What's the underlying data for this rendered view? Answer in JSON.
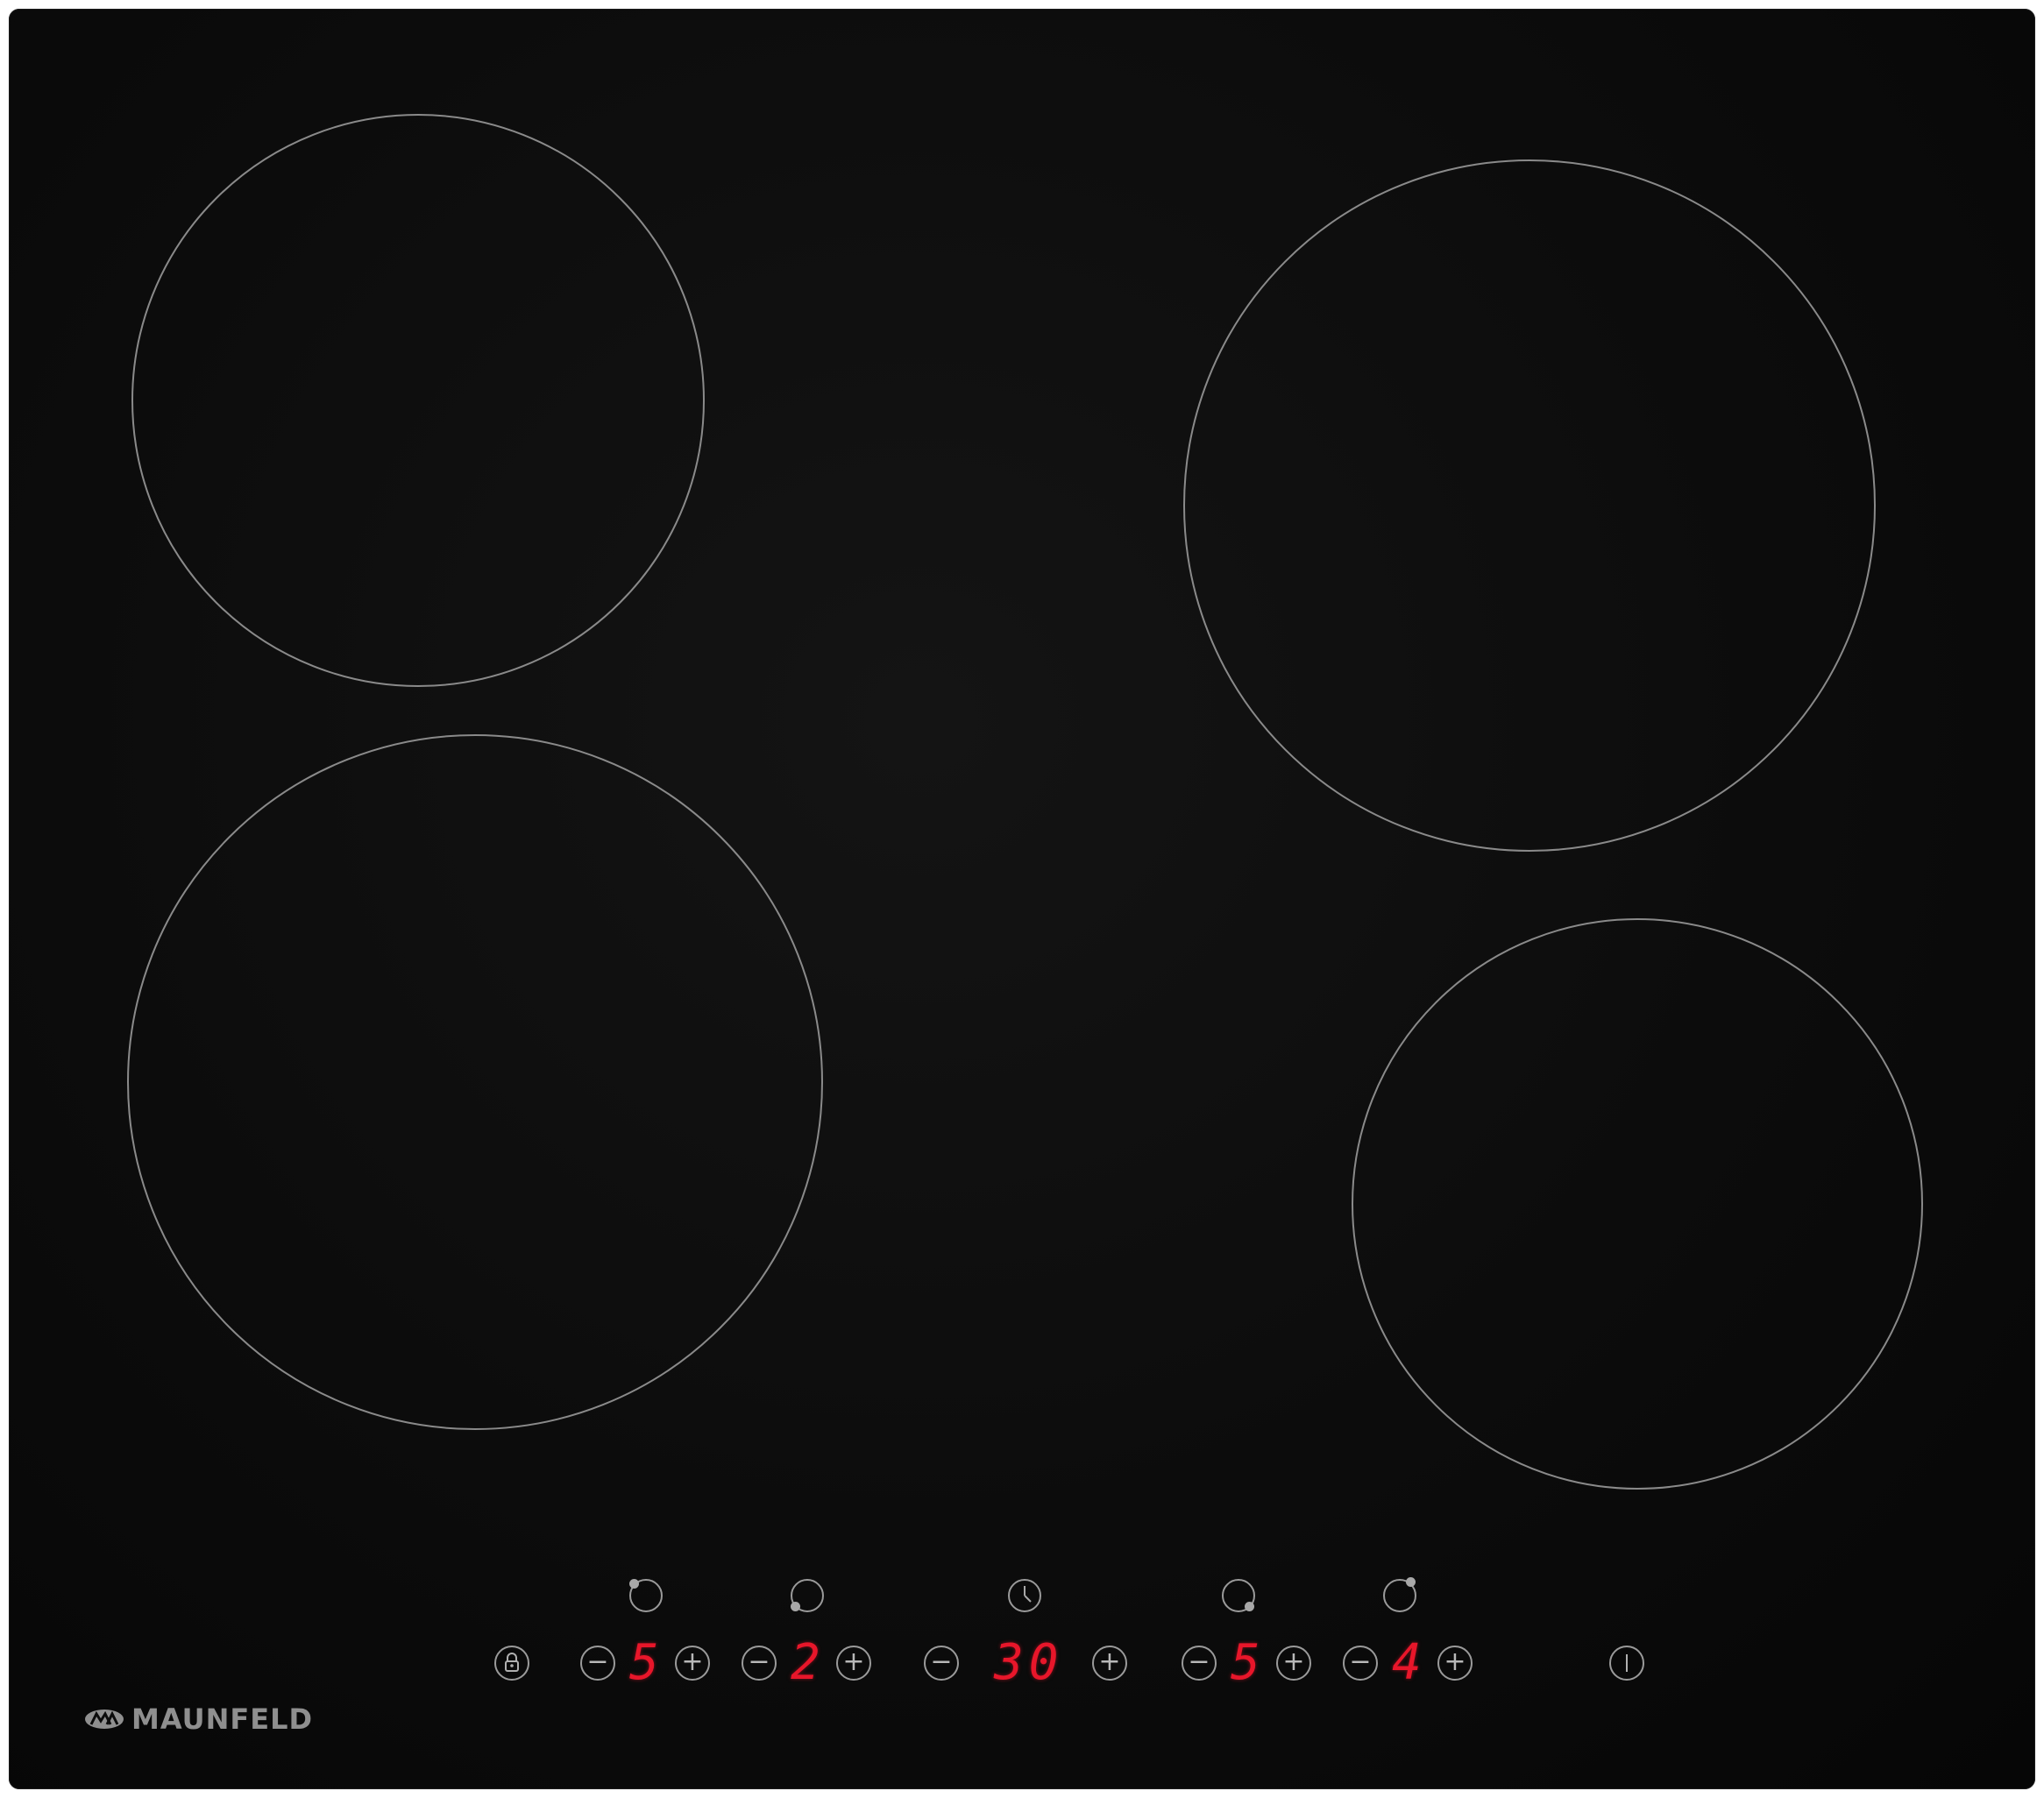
{
  "product": {
    "brand": "MAUNFELD",
    "surface_color": "#0b0b0b",
    "display_color": "#e8162a"
  },
  "controls": {
    "lock_icon": "lock-icon",
    "power_icon": "power-icon",
    "minus_symbol": "−",
    "plus_symbol": "+",
    "zones": [
      {
        "id": "rear-left",
        "level": "5"
      },
      {
        "id": "front-left",
        "level": "2"
      },
      {
        "id": "front-right",
        "level": "5"
      },
      {
        "id": "rear-right",
        "level": "4"
      }
    ],
    "timer": {
      "value": "30",
      "icon": "clock-icon"
    }
  }
}
